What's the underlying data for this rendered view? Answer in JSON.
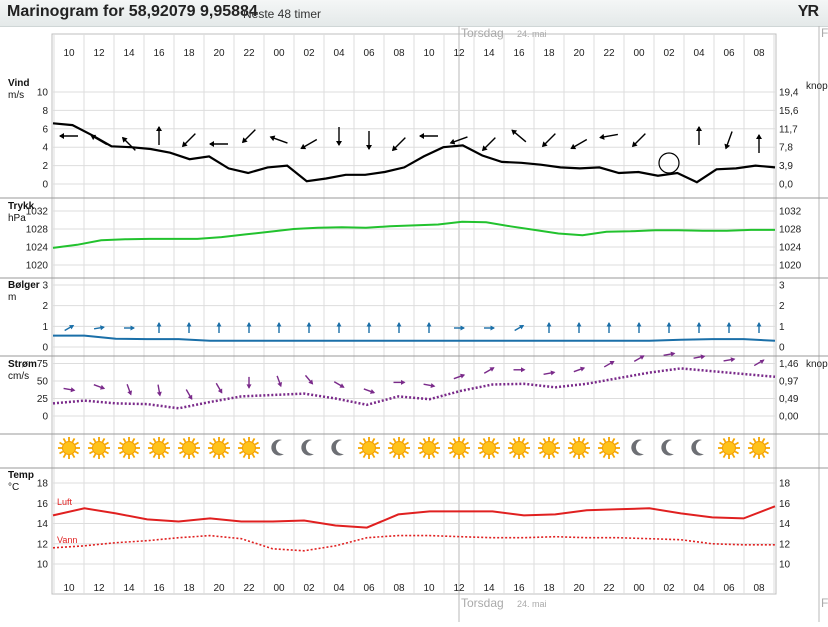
{
  "header": {
    "title": "Marinogram for 58,92079 9,95884",
    "subtitle": "Neste 48 timer",
    "logo": "YR"
  },
  "days": [
    {
      "label": "Torsdag",
      "sub": "24. mai",
      "index": 14
    },
    {
      "label": "Fredag",
      "sub": "25. mai",
      "index": 26
    }
  ],
  "hours": [
    "10",
    "12",
    "14",
    "16",
    "18",
    "20",
    "22",
    "00",
    "02",
    "04",
    "06",
    "08",
    "10",
    "12",
    "14",
    "16",
    "18",
    "20",
    "22",
    "00",
    "02",
    "04",
    "06",
    "08"
  ],
  "colors": {
    "wind": "#000000",
    "pressure": "#22c22e",
    "waves": "#1a6fa8",
    "current": "#7a2a8a",
    "air": "#e02020",
    "water": "#e02020",
    "grid": "#dddddd"
  },
  "chart_data": [
    {
      "type": "line",
      "panel": "wind",
      "title": "Vind",
      "unit": "m/s",
      "unit_right": "knop",
      "yticks": [
        0,
        2,
        4,
        6,
        8,
        10
      ],
      "yticks_right": [
        "0,0",
        "3,9",
        "7,8",
        "11,7",
        "15,6",
        "19,4"
      ],
      "ylim": [
        0,
        10
      ],
      "values": [
        6.6,
        6.4,
        5.3,
        4.1,
        4.0,
        3.8,
        3.4,
        2.7,
        3.0,
        1.7,
        1.2,
        1.8,
        2.0,
        0.3,
        0.6,
        1.0,
        1.0,
        1.3,
        1.8,
        3.0,
        4.0,
        4.2,
        3.1,
        2.4,
        2.3,
        2.1,
        1.8,
        1.7,
        1.8,
        1.2,
        1.3,
        0.9,
        1.2,
        0.2,
        1.6,
        1.7,
        2.0,
        1.8
      ],
      "arrow_dirs": [
        270,
        300,
        315,
        0,
        225,
        270,
        225,
        290,
        240,
        180,
        180,
        225,
        270,
        250,
        225,
        310,
        225,
        240,
        260,
        225,
        0,
        0,
        200,
        0
      ],
      "calm_index": 20
    },
    {
      "type": "line",
      "panel": "pressure",
      "title": "Trykk",
      "unit": "hPa",
      "yticks": [
        1020,
        1024,
        1028,
        1032
      ],
      "ylim": [
        1018,
        1034
      ],
      "values": [
        1023.8,
        1024.5,
        1025.5,
        1025.7,
        1025.8,
        1025.8,
        1025.8,
        1026.2,
        1026.8,
        1027.4,
        1028.0,
        1028.3,
        1028.4,
        1028.3,
        1028.6,
        1028.8,
        1029.0,
        1029.6,
        1029.5,
        1028.6,
        1027.8,
        1027.0,
        1026.6,
        1027.4,
        1027.5,
        1027.7,
        1027.7,
        1027.6,
        1027.6,
        1027.8,
        1027.8
      ]
    },
    {
      "type": "line",
      "panel": "waves",
      "title": "Bølger",
      "unit": "m",
      "yticks": [
        0,
        1,
        2,
        3
      ],
      "ylim": [
        0,
        3
      ],
      "values": [
        0.55,
        0.55,
        0.4,
        0.38,
        0.38,
        0.3,
        0.3,
        0.3,
        0.3,
        0.3,
        0.3,
        0.3,
        0.3,
        0.3,
        0.3,
        0.3,
        0.3,
        0.3,
        0.3,
        0.3,
        0.35,
        0.38,
        0.38,
        0.3
      ],
      "arrow_dirs": [
        60,
        80,
        90,
        0,
        0,
        0,
        0,
        0,
        0,
        0,
        0,
        0,
        0,
        90,
        90,
        60,
        0,
        0,
        0,
        0,
        0,
        0,
        0,
        0
      ]
    },
    {
      "type": "line",
      "panel": "current",
      "title": "Strøm",
      "unit": "cm/s",
      "unit_right": "knop",
      "yticks": [
        0,
        25,
        50,
        75
      ],
      "yticks_right": [
        "0,00",
        "0,49",
        "0,97",
        "1,46"
      ],
      "ylim": [
        -10,
        80
      ],
      "values": [
        18,
        22,
        18,
        17,
        11,
        20,
        28,
        30,
        32,
        25,
        16,
        28,
        24,
        36,
        45,
        46,
        41,
        46,
        54,
        62,
        68,
        64,
        60,
        56
      ],
      "arrow_dirs": [
        100,
        110,
        160,
        170,
        150,
        150,
        180,
        160,
        140,
        120,
        110,
        90,
        100,
        70,
        60,
        90,
        80,
        70,
        60,
        60,
        80,
        80,
        80,
        60
      ]
    },
    {
      "type": "line",
      "panel": "temperature",
      "title": "Temp",
      "unit": "°C",
      "yticks": [
        10,
        12,
        14,
        16,
        18
      ],
      "ylim": [
        10,
        18
      ],
      "series": [
        {
          "name": "Luft",
          "style": "solid",
          "values": [
            14.8,
            15.5,
            15.0,
            14.4,
            14.2,
            14.5,
            14.2,
            14.2,
            14.3,
            13.8,
            13.6,
            14.9,
            15.2,
            15.2,
            15.2,
            14.8,
            14.9,
            15.3,
            15.4,
            15.5,
            15.0,
            14.6,
            14.5,
            15.7
          ]
        },
        {
          "name": "Vann",
          "style": "dotted",
          "values": [
            11.6,
            11.8,
            12.1,
            12.3,
            12.6,
            12.8,
            12.5,
            11.5,
            11.3,
            11.8,
            12.6,
            12.8,
            12.8,
            12.7,
            12.6,
            12.6,
            12.7,
            12.6,
            12.6,
            12.5,
            12.4,
            12.0,
            11.9,
            11.9
          ]
        }
      ]
    },
    {
      "type": "table",
      "panel": "sky",
      "icons": [
        "sun",
        "sun",
        "sun",
        "sun",
        "sun",
        "sun",
        "sun",
        "moon",
        "moon",
        "moon",
        "sun",
        "sun",
        "sun",
        "sun",
        "sun",
        "sun",
        "sun",
        "sun",
        "sun",
        "moon",
        "moon",
        "moon",
        "sun",
        "sun"
      ]
    }
  ]
}
